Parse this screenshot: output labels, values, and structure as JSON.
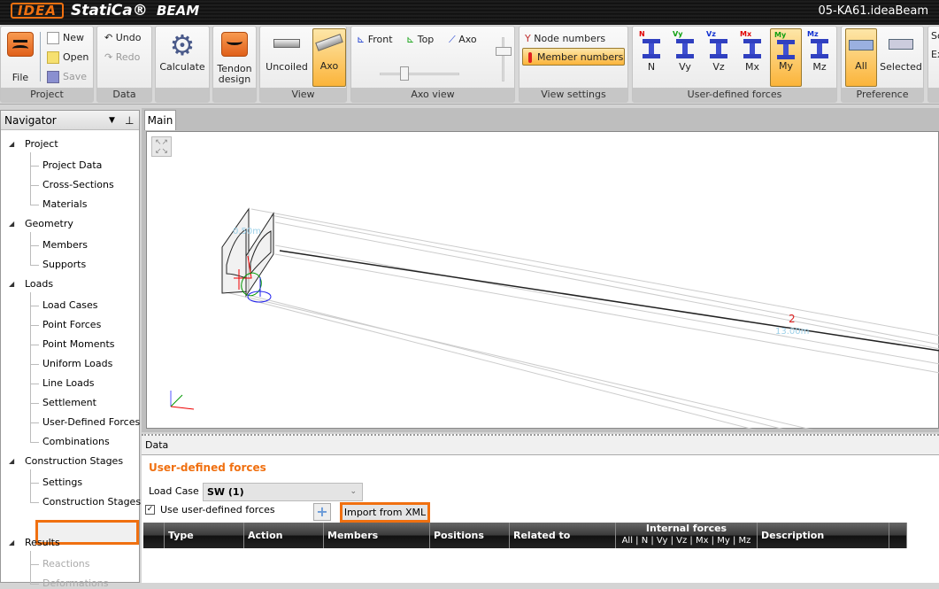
{
  "titlebar": {
    "logo": "IDEA",
    "brand": "StatiCa®",
    "product": "BEAM",
    "file": "05-KA61.ideaBeam"
  },
  "ribbon": {
    "project": {
      "label": "Project",
      "file": "File",
      "new": "New",
      "open": "Open",
      "save": "Save"
    },
    "data": {
      "label": "Data",
      "undo": "Undo",
      "redo": "Redo"
    },
    "calculate": "Calculate",
    "tendon": "Tendon design",
    "view": {
      "label": "View",
      "uncoiled": "Uncoiled",
      "axo": "Axo"
    },
    "axo_view": {
      "label": "Axo view",
      "front": "Front",
      "top": "Top",
      "axo": "Axo"
    },
    "view_settings": {
      "label": "View settings",
      "node_numbers": "Node numbers",
      "member_numbers": "Member numbers"
    },
    "udf": {
      "label": "User-defined forces",
      "buttons": [
        "N",
        "Vy",
        "Vz",
        "Mx",
        "My",
        "Mz"
      ],
      "active": "My",
      "colors": [
        "#e00000",
        "#10a010",
        "#1030d0",
        "#e00000",
        "#10a010",
        "#1030d0"
      ]
    },
    "preference": {
      "label": "Preference",
      "all": "All",
      "selected": "Selected"
    },
    "partial": {
      "a": "Sc",
      "b": "Ex"
    }
  },
  "navigator": {
    "title": "Navigator",
    "groups": [
      {
        "label": "Project",
        "items": [
          "Project Data",
          "Cross-Sections",
          "Materials"
        ]
      },
      {
        "label": "Geometry",
        "items": [
          "Members",
          "Supports"
        ]
      },
      {
        "label": "Loads",
        "items": [
          "Load Cases",
          "Point Forces",
          "Point Moments",
          "Uniform Loads",
          "Line Loads",
          "Settlement",
          "User-Defined Forces",
          "Combinations"
        ]
      },
      {
        "label": "Construction Stages",
        "items": [
          "Settings",
          "Construction Stages"
        ]
      },
      {
        "label": "Results",
        "items": [
          "Reactions",
          "Deformations"
        ]
      }
    ]
  },
  "main": {
    "tab": "Main",
    "member_label": "2",
    "length_label": "13.00m",
    "small_label": "0.50m",
    "node_label": "1"
  },
  "data_panel": {
    "header": "Data",
    "title": "User-defined forces",
    "load_case_label": "Load Case",
    "load_case_value": "SW (1)",
    "use_label": "Use user-defined forces",
    "use_checked": true,
    "import_button": "Import from XML",
    "columns": [
      "Type",
      "Action",
      "Members",
      "Positions",
      "Related to",
      "Internal forces",
      "Description"
    ],
    "internal_sub": "All | N | Vy | Vz | Mx | My | Mz"
  }
}
